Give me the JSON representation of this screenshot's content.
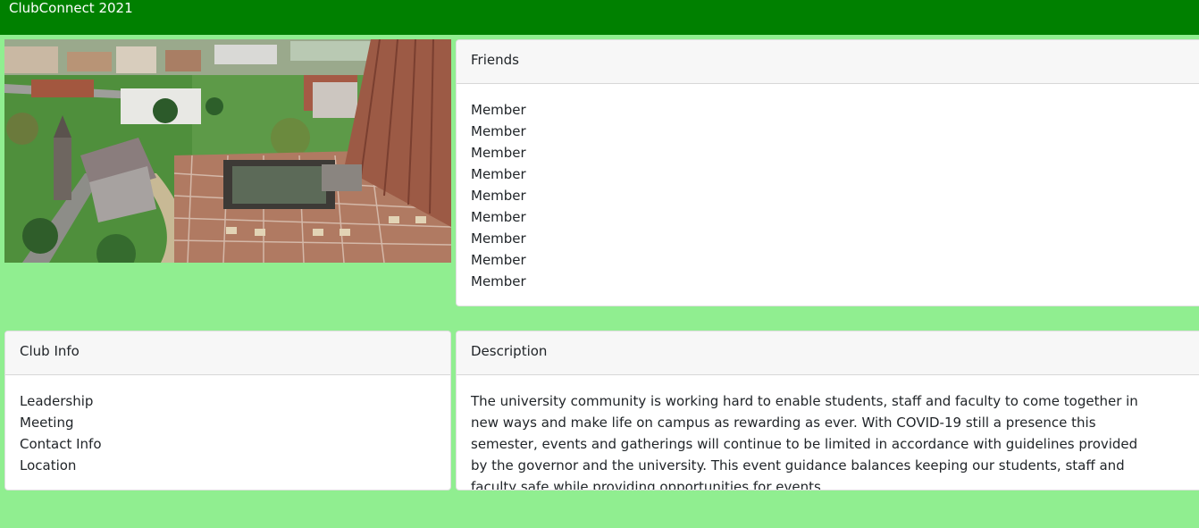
{
  "navbar": {
    "brand": "ClubConnect 2021"
  },
  "friends": {
    "title": "Friends",
    "members": [
      "Member",
      "Member",
      "Member",
      "Member",
      "Member",
      "Member",
      "Member",
      "Member",
      "Member"
    ]
  },
  "club_info": {
    "title": "Club Info",
    "items": [
      "Leadership",
      "Meeting",
      "Contact Info",
      "Location"
    ]
  },
  "description": {
    "title": "Description",
    "text": "The university community is working hard to enable students, staff and faculty to come together in new ways and make life on campus as rewarding as ever. With COVID-19 still a presence this semester, events and gatherings will continue to be limited in accordance with guidelines provided by the governor and the university. This event guidance balances keeping our students, staff and faculty safe while providing opportunities for events."
  },
  "colors": {
    "navbar_bg": "#008000",
    "page_bg": "#90ee90",
    "card_header_bg": "#f7f7f7"
  }
}
